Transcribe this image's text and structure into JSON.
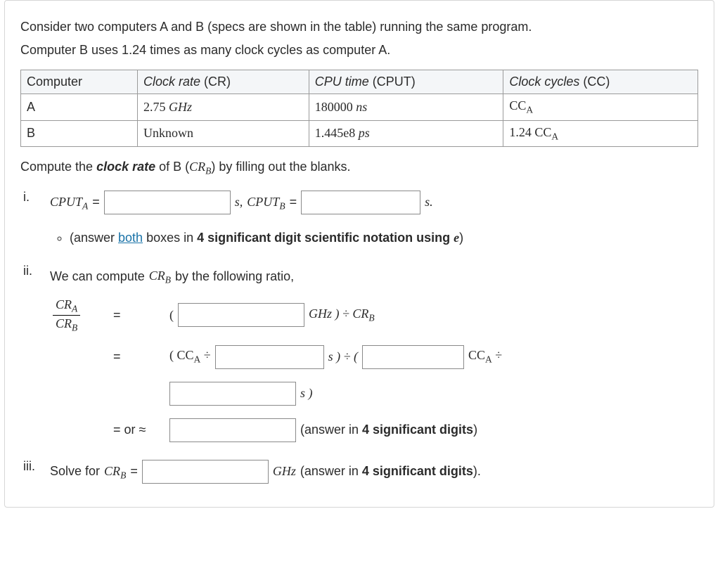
{
  "intro": {
    "line1": "Consider two computers A and B (specs are shown in the table) running the same program.",
    "line2": "Computer B uses 1.24 times as many clock cycles as computer A."
  },
  "table": {
    "headers": {
      "computer": "Computer",
      "cr": "Clock rate",
      "cr_abbr": " (CR)",
      "cput": "CPU time",
      "cput_abbr": " (CPUT)",
      "cc": "Clock cycles",
      "cc_abbr": " (CC)"
    },
    "rows": [
      {
        "name": "A",
        "cr_val": "2.75 ",
        "cr_unit": "GHz",
        "cput_val": "180000 ",
        "cput_unit": "ns",
        "cc_pre": "CC",
        "cc_sub": "A",
        "cc_post": ""
      },
      {
        "name": "B",
        "cr_val": "Unknown",
        "cr_unit": "",
        "cput_val": "1.445e8 ",
        "cput_unit": "ps",
        "cc_pre": "1.24 CC",
        "cc_sub": "A",
        "cc_post": ""
      }
    ]
  },
  "prompt": {
    "pre": "Compute the ",
    "em": "clock rate",
    "mid": " of B (",
    "var": "CR",
    "sub": "B",
    "post": ") by filling out the blanks."
  },
  "items": {
    "i": {
      "label": "i.",
      "cputa": "CPUT",
      "cputa_sub": "A",
      "eq": " = ",
      "s_comma": "s, ",
      "cputb": "CPUT",
      "cputb_sub": "B",
      "s_period": "s.",
      "note_pre": "(answer ",
      "note_link": "both",
      "note_mid": " boxes in ",
      "note_bold": "4 significant digit scientific notation using ",
      "note_e": "e",
      "note_post": ")"
    },
    "ii": {
      "label": "ii.",
      "lead": "We can compute ",
      "crb": "CR",
      "crb_sub": "B",
      "tail": " by the following ratio,",
      "frac_num": "CR",
      "frac_num_sub": "A",
      "frac_den": "CR",
      "frac_den_sub": "B",
      "eq": "=",
      "open": "(",
      "ghz_close": "GHz ) ÷ ",
      "crb2": "CR",
      "crb2_sub": "B",
      "line2_open": "( CC",
      "line2_sub": "A",
      "line2_div": " ÷",
      "line2_s": "s ) ÷ (",
      "line2_cca2": "CC",
      "line2_cca2_sub": "A",
      "line2_cca2_div": " ÷",
      "line3_s": "s )",
      "line4_eq": "= or ≈",
      "line4_note": "(answer in ",
      "line4_bold": "4 significant digits",
      "line4_close": ")"
    },
    "iii": {
      "label": "iii.",
      "lead": "Solve for ",
      "crb": "CR",
      "crb_sub": "B",
      "eq": " = ",
      "ghz": "GHz ",
      "note_pre": "(answer in ",
      "note_bold": "4 significant digits",
      "note_post": ")."
    }
  }
}
